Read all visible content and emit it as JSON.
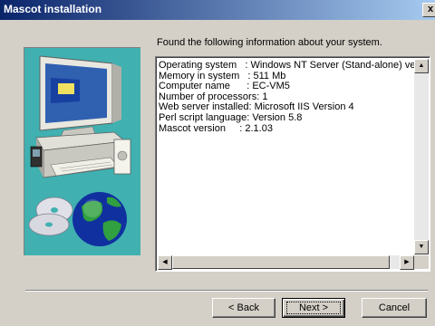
{
  "window": {
    "title": "Mascot installation",
    "close_glyph": "x"
  },
  "intro": "Found the following information about your system.",
  "info_lines": [
    "Operating system   : Windows NT Server (Stand-alone) vers",
    "Memory in system   : 511 Mb",
    "Computer name      : EC-VM5",
    "Number of processors: 1",
    "Web server installed: Microsoft IIS Version 4",
    "Perl script language: Version 5.8",
    "Mascot version     : 2.1.03"
  ],
  "buttons": {
    "back_label": "< Back",
    "next_label": "Next >",
    "cancel_label": "Cancel"
  },
  "icons": {
    "art": "computer-and-globe-illustration",
    "close": "close-icon"
  },
  "colors": {
    "title_start": "#0a246a",
    "title_end": "#a6caf0",
    "face": "#d4d0c8",
    "art_bg": "#40b0b0"
  }
}
